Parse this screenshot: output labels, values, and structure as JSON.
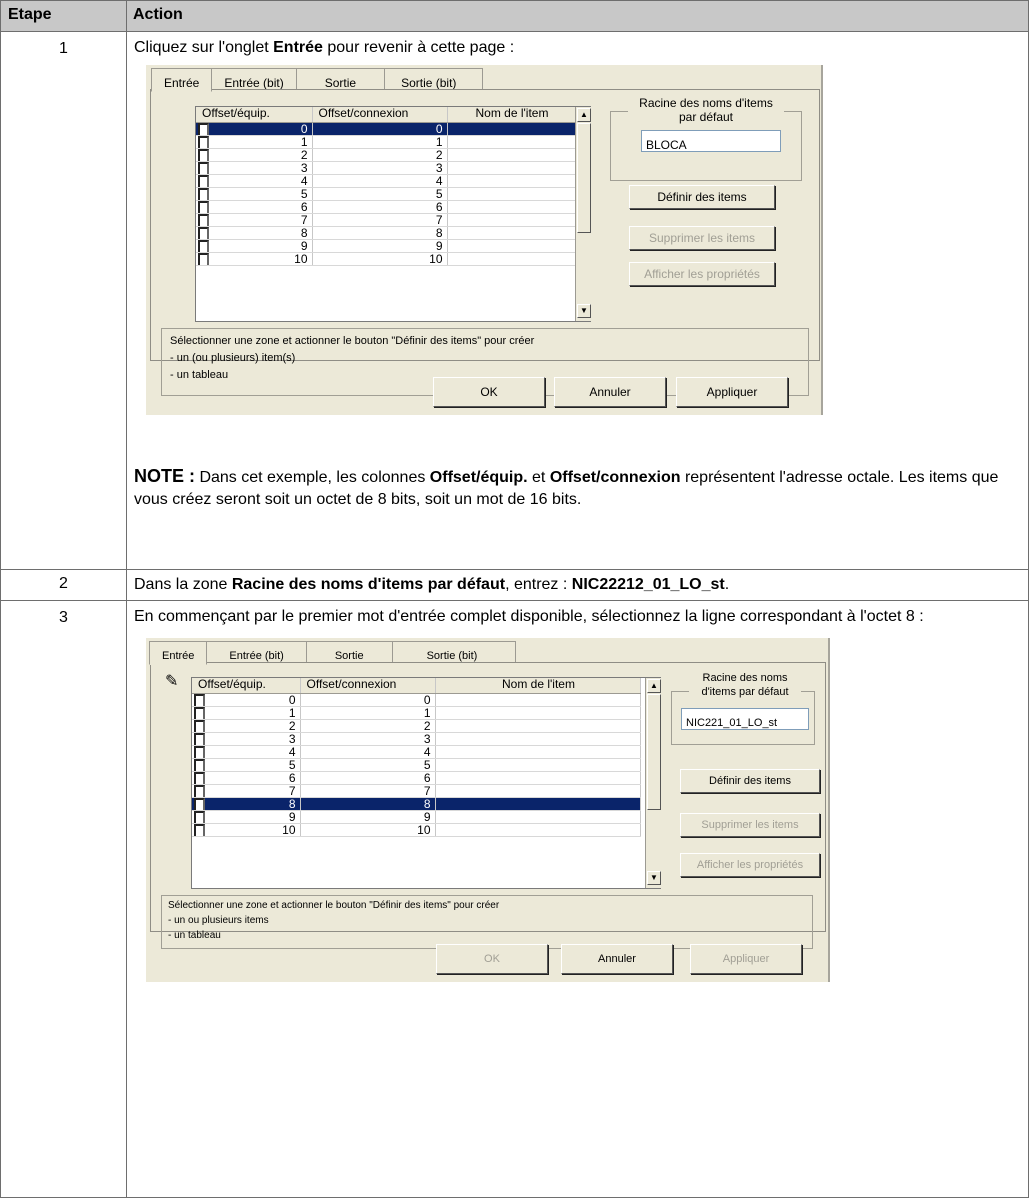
{
  "table": {
    "headers": [
      "Etape",
      "Action"
    ]
  },
  "step1": {
    "num": "1",
    "instruction_pre": "Cliquez sur l'onglet ",
    "instruction_bold": "Entrée",
    "instruction_post": " pour revenir à cette page :",
    "note_label": "NOTE :",
    "note_t1": " Dans cet exemple, les colonnes ",
    "note_b1": "Offset/équip.",
    "note_t2": " et ",
    "note_b2": "Offset/connexion",
    "note_t3": " représentent l'adresse octale. Les items que vous créez seront soit un octet de 8 bits, soit un mot de 16 bits."
  },
  "step2": {
    "num": "2",
    "t1": "Dans la zone ",
    "b1": "Racine des noms d'items par défaut",
    "t2": ", entrez : ",
    "b2": "NIC22212_01_LO_st",
    "t3": "."
  },
  "step3": {
    "num": "3",
    "text": "En commençant par le premier mot d'entrée complet disponible, sélectionnez la ligne correspondant à l'octet 8 :"
  },
  "dialog1": {
    "tabs": [
      "Entrée",
      "Entrée (bit)",
      "Sortie",
      "Sortie (bit)"
    ],
    "col_headers": [
      "Offset/équip.",
      "Offset/connexion",
      "Nom de l'item"
    ],
    "rows": [
      "0",
      "1",
      "2",
      "3",
      "4",
      "5",
      "6",
      "7",
      "8",
      "9",
      "10"
    ],
    "selected_row": "0",
    "root_group_title": "Racine des noms d'items par défaut",
    "root_value": "BLOCA",
    "btn_define": "Définir des items",
    "btn_delete": "Supprimer les items",
    "btn_props": "Afficher les propriétés",
    "info_lines": [
      "Sélectionner une zone et actionner le bouton \"Définir des items\" pour créer",
      "- un (ou plusieurs) item(s)",
      "- un tableau"
    ],
    "btn_ok": "OK",
    "btn_cancel": "Annuler",
    "btn_apply": "Appliquer"
  },
  "dialog3": {
    "tabs": [
      "Entrée",
      "Entrée (bit)",
      "Sortie",
      "Sortie (bit)"
    ],
    "col_headers": [
      "Offset/équip.",
      "Offset/connexion",
      "Nom de l'item"
    ],
    "rows": [
      "0",
      "1",
      "2",
      "3",
      "4",
      "5",
      "6",
      "7",
      "8",
      "9",
      "10"
    ],
    "selected_row": "8",
    "root_group_title": "Racine des noms d'items par défaut",
    "root_value": "NIC221_01_LO_st",
    "btn_define": "Définir des items",
    "btn_delete": "Supprimer les items",
    "btn_props": "Afficher les propriétés",
    "info_lines": [
      "Sélectionner une zone et actionner le bouton \"Définir des items\" pour créer",
      "- un ou plusieurs items",
      "- un tableau"
    ],
    "btn_ok": "OK",
    "btn_cancel": "Annuler",
    "btn_apply": "Appliquer"
  },
  "icons": {
    "pencil": "pencil-icon",
    "scroll_up": "arrow-up-icon",
    "scroll_down": "arrow-down-icon"
  }
}
